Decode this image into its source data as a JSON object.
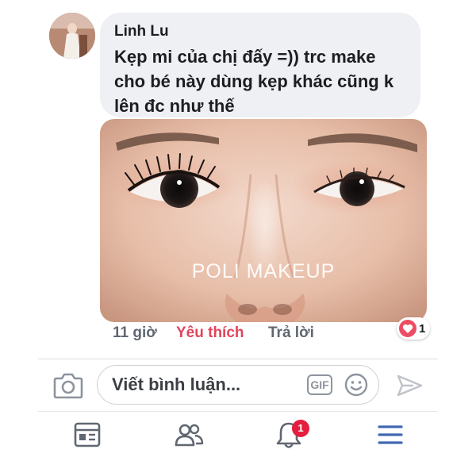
{
  "comment": {
    "author": "Linh Lu",
    "text": "Kẹp mi của chị đấy =)) trc make cho bé này dùng kẹp khác cũng k lên đc như thế",
    "photo_watermark": "POLI MAKEUP",
    "time": "11 giờ",
    "like_label": "Yêu thích",
    "reply_label": "Trả lời",
    "reaction": {
      "icon": "heart-icon",
      "count": "1",
      "color": "#ec4d62"
    }
  },
  "composer": {
    "placeholder": "Viết bình luận...",
    "gif_label": "GIF",
    "icons": [
      "camera-icon",
      "emoji-icon",
      "send-icon"
    ]
  },
  "bottom_nav": {
    "items": [
      {
        "name": "news-feed",
        "icon": "news-feed-icon"
      },
      {
        "name": "friends",
        "icon": "friends-icon"
      },
      {
        "name": "notifications",
        "icon": "bell-icon",
        "badge": "1"
      },
      {
        "name": "menu",
        "icon": "menu-icon",
        "accent": "#4267b2"
      }
    ]
  },
  "colors": {
    "bubble_bg": "#eef0f3",
    "like_active": "#e0455d",
    "badge": "#e41e3f",
    "accent": "#4267b2"
  }
}
